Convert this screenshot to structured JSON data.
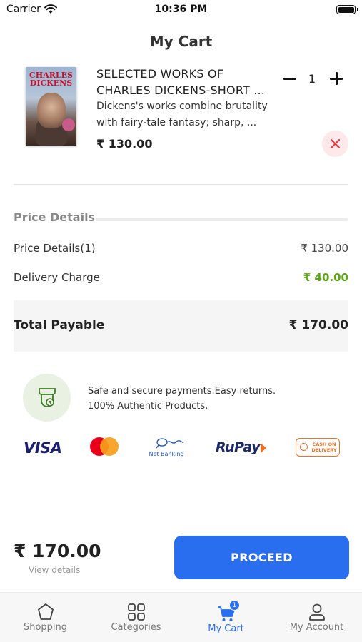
{
  "status_bar": {
    "carrier": "Carrier",
    "time": "10:36 PM"
  },
  "header": {
    "title": "My Cart"
  },
  "cart_item": {
    "cover_author": "CHARLES DICKENS",
    "title_line1": "SELECTED WORKS OF",
    "title_line2": "CHARLES DICKENS-SHORT ...",
    "desc_line1": "Dickens's works combine brutality",
    "desc_line2": "with fairy-tale fantasy; sharp, ...",
    "price": "₹ 130.00",
    "quantity": "1"
  },
  "price_details": {
    "header": "Price Details",
    "rows": [
      {
        "label": "Price Details(1)",
        "value": "₹ 130.00"
      },
      {
        "label": "Delivery Charge",
        "value": "₹ 40.00"
      }
    ],
    "total_label": "Total Payable",
    "total_value": "₹ 170.00"
  },
  "trust": {
    "line1": "Safe and secure payments.Easy returns.",
    "line2": "100% Authentic Products."
  },
  "payment_methods": {
    "visa": "VISA",
    "netbanking": "Net Banking",
    "rupay": "RuPay",
    "cod_line1": "CASH ON",
    "cod_line2": "DELIVERY"
  },
  "checkout": {
    "total": "₹ 170.00",
    "view_details": "View details",
    "proceed_label": "PROCEED"
  },
  "tab_bar": {
    "tabs": [
      {
        "label": "Shopping",
        "icon": "shopping-icon"
      },
      {
        "label": "Categories",
        "icon": "categories-icon"
      },
      {
        "label": "My Cart",
        "icon": "cart-icon",
        "badge": "1",
        "active": true
      },
      {
        "label": "My Account",
        "icon": "account-icon"
      }
    ]
  },
  "colors": {
    "accent": "#2a6ef0",
    "delivery_green": "#5aa716",
    "remove_red": "#e53945"
  }
}
